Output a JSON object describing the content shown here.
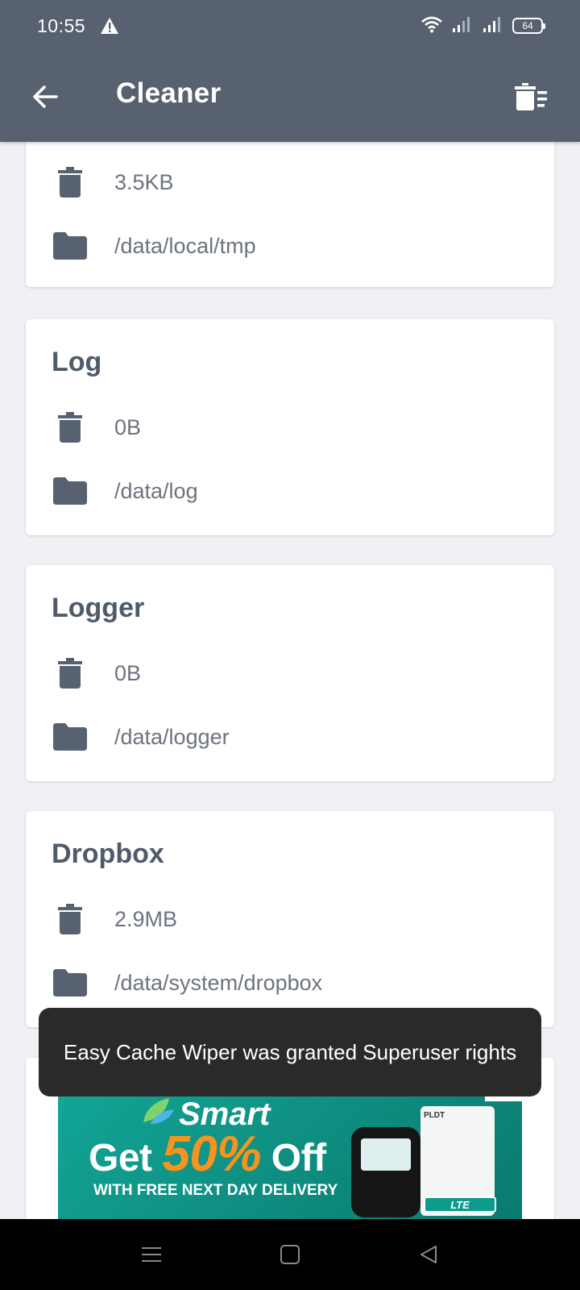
{
  "status_bar": {
    "time": "10:55",
    "battery": "64"
  },
  "app_bar": {
    "title": "Cleaner"
  },
  "partial_card": {
    "size": "3.5KB",
    "path": "/data/local/tmp"
  },
  "cards": [
    {
      "title": "Log",
      "size": "0B",
      "path": "/data/log"
    },
    {
      "title": "Logger",
      "size": "0B",
      "path": "/data/logger"
    },
    {
      "title": "Dropbox",
      "size": "2.9MB",
      "path": "/data/system/dropbox"
    }
  ],
  "toast": {
    "message": "Easy Cache Wiper was granted Superuser rights"
  },
  "ad": {
    "brand": "Smart",
    "headline_prefix": "Get",
    "headline_percent": "50%",
    "headline_suffix": "Off",
    "subline": "WITH FREE NEXT DAY DELIVERY",
    "router_label": "PLDT",
    "badge": "LTE"
  },
  "colors": {
    "app_bar": "#576170",
    "background": "#eff1f5",
    "card_title": "#4f5a6a",
    "icon": "#576170",
    "toast": "#2a2a2a",
    "ad_green": "#12a596",
    "ad_orange": "#f8931d"
  },
  "icons": {
    "back": "arrow-left-icon",
    "clean": "trash-list-icon",
    "size": "trash-icon",
    "path": "folder-icon"
  }
}
